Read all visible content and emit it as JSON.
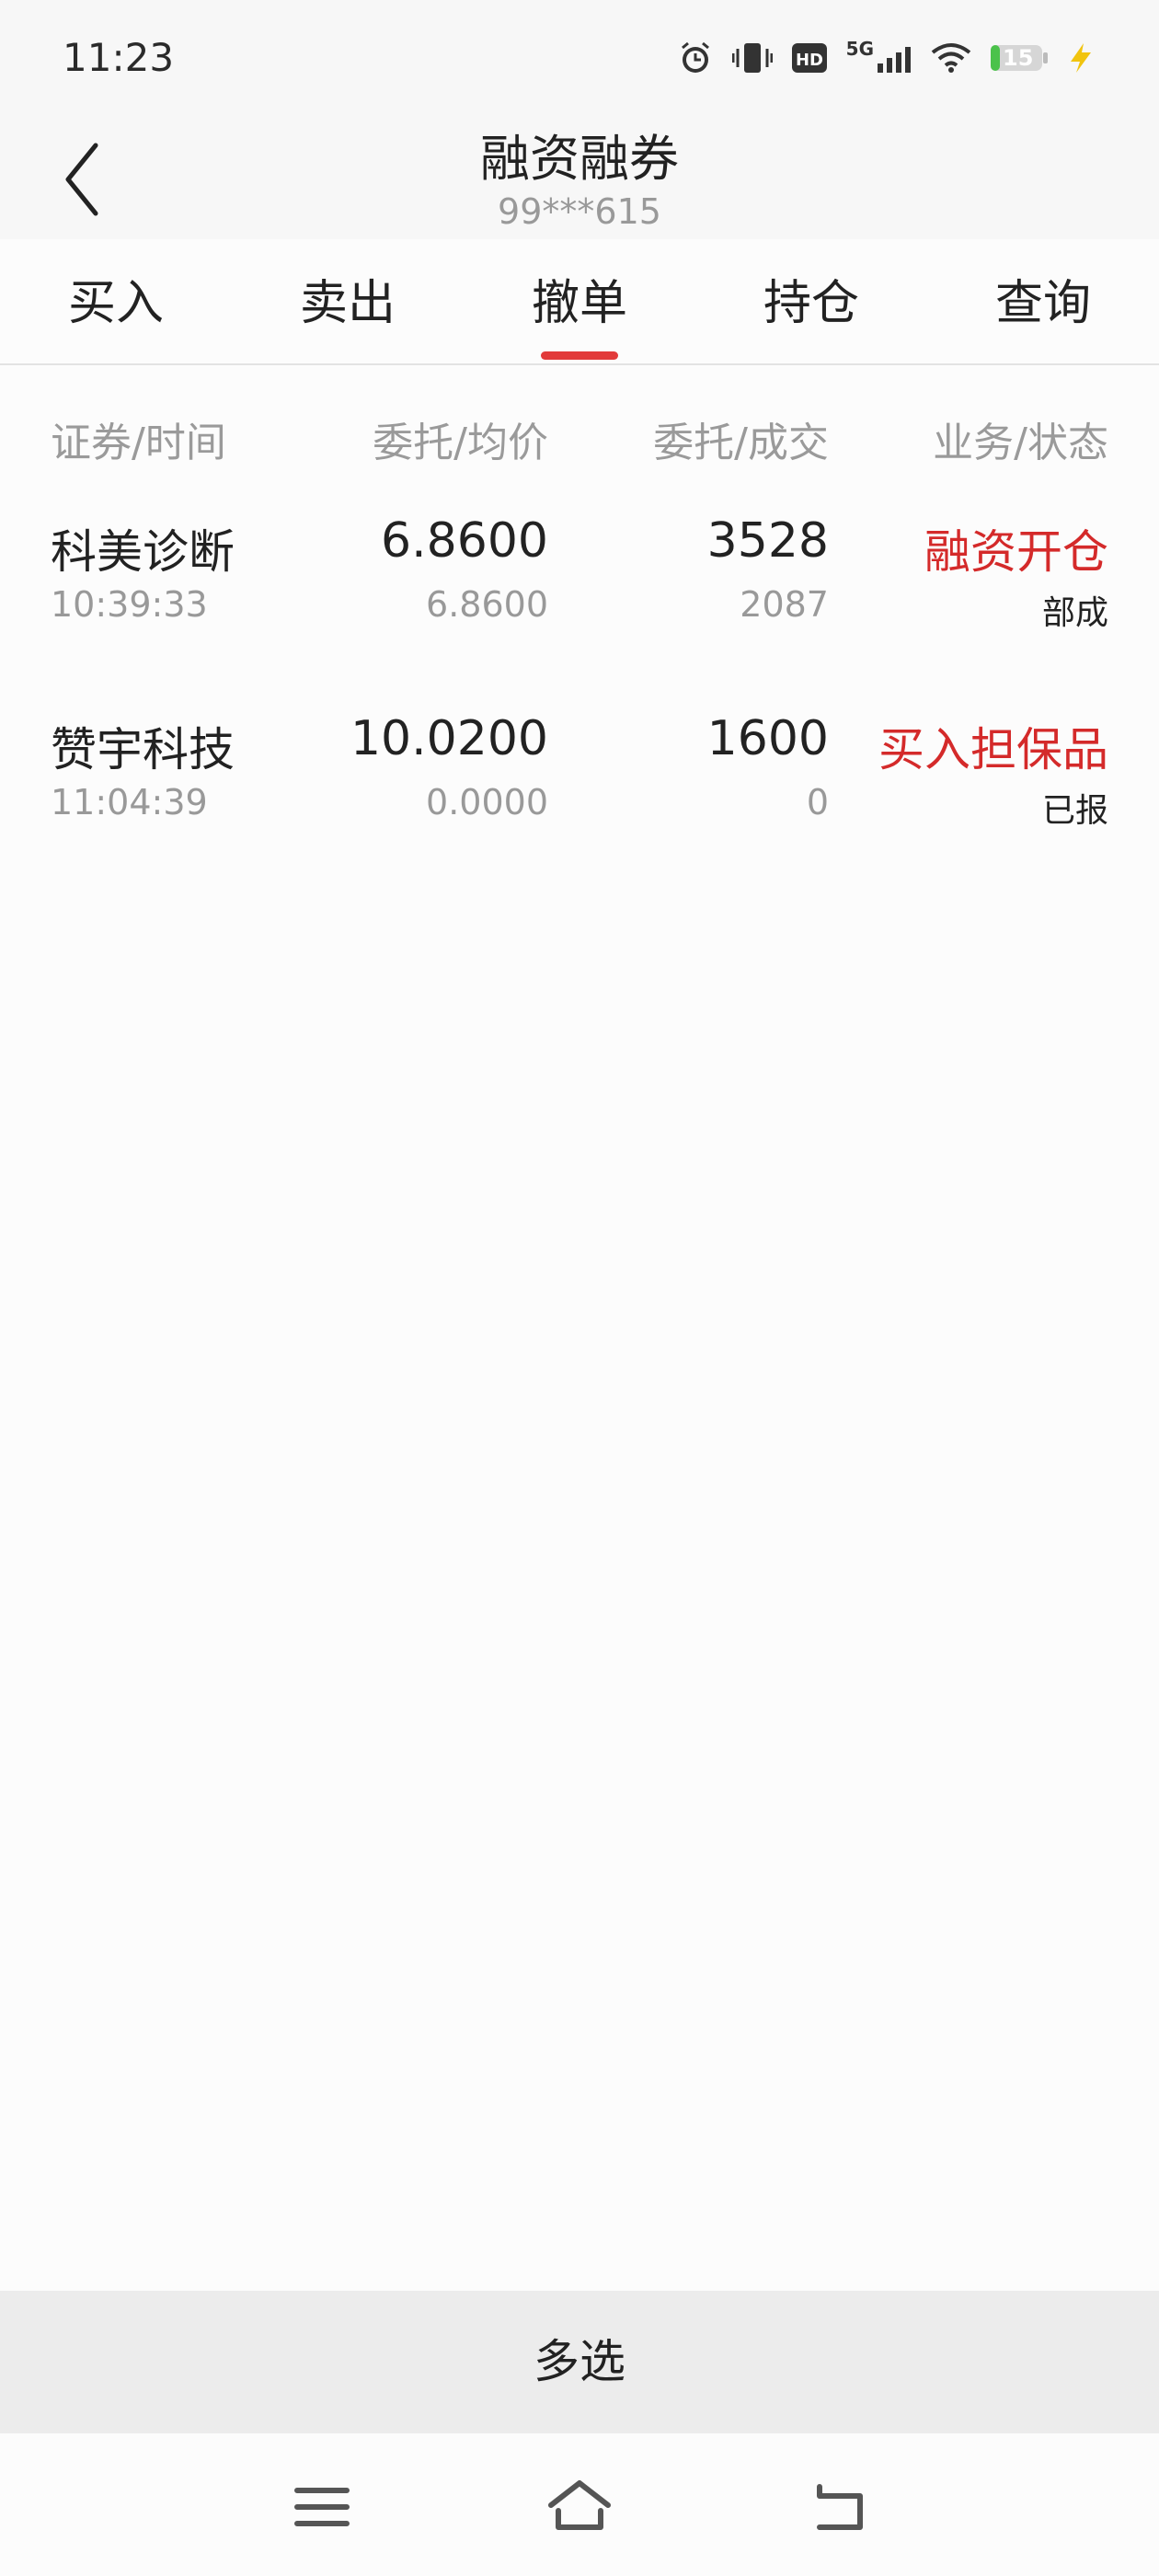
{
  "status_bar": {
    "time": "11:23",
    "network": "5G",
    "battery": "15",
    "icons": [
      "alarm-icon",
      "vibrate-icon",
      "hd-icon",
      "signal-5g-icon",
      "wifi-icon",
      "battery-icon",
      "charging-icon"
    ]
  },
  "header": {
    "title": "融资融券",
    "account": "99***615",
    "back_icon": "chevron-left-icon"
  },
  "tabs": [
    {
      "label": "买入",
      "active": false
    },
    {
      "label": "卖出",
      "active": false
    },
    {
      "label": "撤单",
      "active": true
    },
    {
      "label": "持仓",
      "active": false
    },
    {
      "label": "查询",
      "active": false
    }
  ],
  "table": {
    "headers": [
      "证券/时间",
      "委托/均价",
      "委托/成交",
      "业务/状态"
    ],
    "rows": [
      {
        "name": "科美诊断",
        "time": "10:39:33",
        "order_price": "6.8600",
        "avg_price": "6.8600",
        "order_qty": "3528",
        "filled_qty": "2087",
        "business": "融资开仓",
        "status": "部成"
      },
      {
        "name": "赞宇科技",
        "time": "11:04:39",
        "order_price": "10.0200",
        "avg_price": "0.0000",
        "order_qty": "1600",
        "filled_qty": "0",
        "business": "买入担保品",
        "status": "已报"
      }
    ]
  },
  "bottom": {
    "multi_select_label": "多选"
  },
  "nav_bar": {
    "icons": [
      "menu-icon",
      "home-icon",
      "back-icon"
    ]
  },
  "colors": {
    "accent": "#e23a3a",
    "business_text": "#d42a2a",
    "muted": "#999999"
  }
}
